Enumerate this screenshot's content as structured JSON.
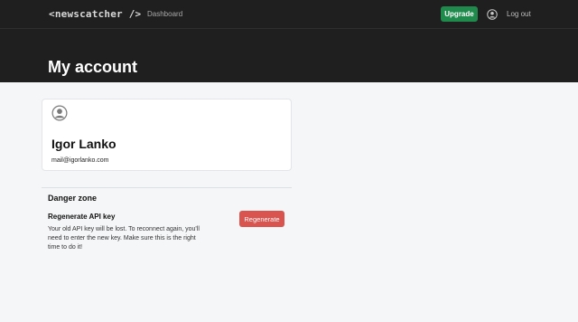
{
  "header": {
    "logo": "<newscatcher />",
    "nav": {
      "dashboard": "Dashboard"
    },
    "upgrade_label": "Upgrade",
    "user_icon": "user-circle-icon",
    "logout_label": "Log out",
    "colors": {
      "bar": "#1f1f1f",
      "upgrade": "#1f8a4c"
    }
  },
  "page": {
    "title": "My account"
  },
  "profile": {
    "avatar_icon": "user-circle-icon",
    "name": "Igor Lanko",
    "email": "mail@igorlanko.com"
  },
  "danger_zone": {
    "heading": "Danger zone",
    "regenerate": {
      "title": "Regenerate API key",
      "description": "Your old API key will be lost. To reconnect again, you'll need to enter the new key. Make sure this is the right time to do it!",
      "button_label": "Regenerate",
      "button_color": "#d9534f"
    }
  }
}
